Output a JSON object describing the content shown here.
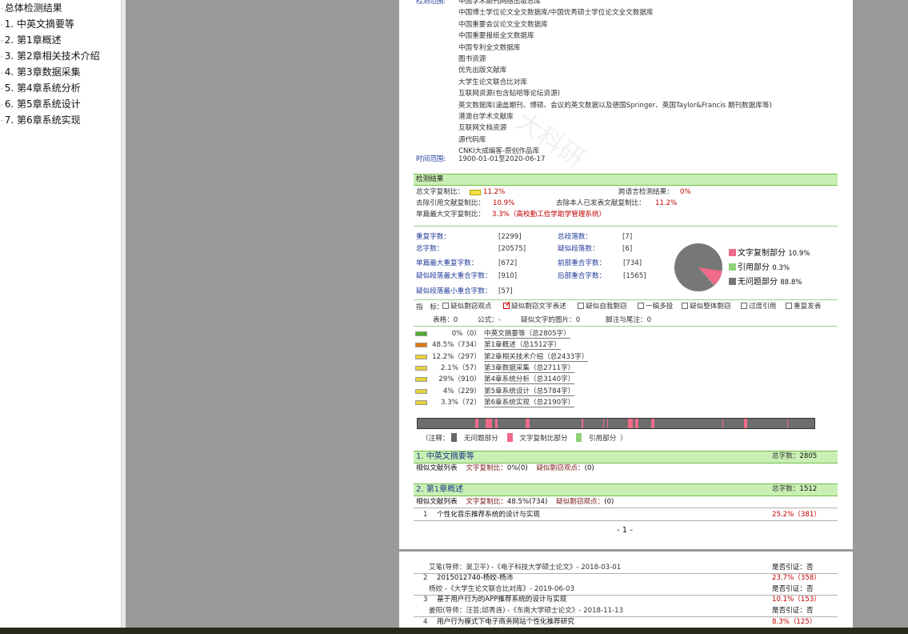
{
  "outline": {
    "items": [
      {
        "label": "总体检测结果"
      },
      {
        "label": "1. 中英文摘要等"
      },
      {
        "label": "2. 第1章概述"
      },
      {
        "label": "3. 第2章相关技术介绍"
      },
      {
        "label": "4. 第3章数据采集"
      },
      {
        "label": "5. 第4章系统分析"
      },
      {
        "label": "6. 第5章系统设计"
      },
      {
        "label": "7. 第6章系统实现"
      }
    ]
  },
  "report": {
    "scope_label": "检测范围:",
    "scope_items": [
      "中国学术期刊网络出版总库",
      "中国博士学位论文全文数据库/中国优秀硕士学位论文全文数据库",
      "中国重要会议论文全文数据库",
      "中国重要报纸全文数据库",
      "中国专利全文数据库",
      "图书资源",
      "优先出版文献库",
      "大学生论文联合比对库",
      "互联网资源(包含贴吧等论坛资源)",
      "英文数据库(涵盖期刊、博硕、会议的英文数据以及德国Springer、英国Taylor&Francis 期刊数据库等)",
      "港澳台学术文献库",
      "互联网文档资源",
      "源代码库",
      "CNKI大成编客-原创作品库"
    ],
    "time_label": "时间范围:",
    "time_value": "1900-01-01至2020-06-17",
    "watermark": "大科研",
    "results_title": "检测结果",
    "total_copy_label": "总文字复制比：",
    "total_copy_value": "11.2%",
    "cross_lang_label": "跨语言检测结果：",
    "cross_lang_value": "0%",
    "excl_ref_label": "去除引用文献复制比：",
    "excl_ref_value": "10.9%",
    "excl_self_label": "去除本人已发表文献复制比：",
    "excl_self_value": "11.2%",
    "single_max_label": "单篇最大文字复制比：",
    "single_max_value": "3.3%（高校勤工俭学助学管理系统）",
    "stats": {
      "dup_chars_label": "重复字数：",
      "dup_chars": "[2299]",
      "total_paras_label": "总段落数：",
      "total_paras": "[7]",
      "total_chars_label": "总字数：",
      "total_chars": "[20575]",
      "sus_paras_label": "疑似段落数：",
      "sus_paras": "[6]",
      "single_max_dup_label": "单篇最大重复字数：",
      "single_max_dup": "[672]",
      "front_overlap_label": "前部重合字数：",
      "front_overlap": "[734]",
      "sus_para_max_label": "疑似段落最大重合字数：",
      "sus_para_max": "[910]",
      "back_overlap_label": "后部重合字数：",
      "back_overlap": "[1565]",
      "sus_para_min_label": "疑似段落最小重合字数：",
      "sus_para_min": "[57]"
    },
    "pie_legend": [
      {
        "label": "文字复制部分",
        "value": "10.9%",
        "color": "#f06a8a"
      },
      {
        "label": "引用部分",
        "value": "0.3%",
        "color": "#8fd27a"
      },
      {
        "label": "无问题部分",
        "value": "88.8%",
        "color": "#777777"
      }
    ],
    "indicators_label": "指　标：",
    "indicators": [
      {
        "label": "疑似剽窃观点",
        "checked": false
      },
      {
        "label": "疑似剽窃文字表述",
        "checked": true
      },
      {
        "label": "疑似自我剽窃",
        "checked": false
      },
      {
        "label": "一稿多投",
        "checked": false
      },
      {
        "label": "疑似整体剽窃",
        "checked": false
      },
      {
        "label": "过度引用",
        "checked": false
      },
      {
        "label": "重复发表",
        "checked": false
      }
    ],
    "misc_line": {
      "tables": "表格：0",
      "formulas": "公式：-",
      "images": "疑似文字的图片：0",
      "footnotes": "脚注与尾注：0"
    },
    "chapters": [
      {
        "pct": "0%（0）",
        "title": "中英文摘要等（总2805字）",
        "color": "#4caf30"
      },
      {
        "pct": "48.5%（734）",
        "title": "第1章概述（总1512字）",
        "color": "#e07a10"
      },
      {
        "pct": "12.2%（297）",
        "title": "第2章相关技术介绍（总2433字）",
        "color": "#e6d23a"
      },
      {
        "pct": "2.1%（57）",
        "title": "第3章数据采集（总2711字）",
        "color": "#e6d23a"
      },
      {
        "pct": "29%（910）",
        "title": "第4章系统分析（总3140字）",
        "color": "#e6d23a"
      },
      {
        "pct": "4%（229）",
        "title": "第5章系统设计（总5784字）",
        "color": "#e6d23a"
      },
      {
        "pct": "3.3%（72）",
        "title": "第6章系统实现（总2190字）",
        "color": "#e6d23a"
      }
    ],
    "legend_note_prefix": "（注释：",
    "legend_note_items": [
      {
        "label": "无问题部分",
        "color": "#666666"
      },
      {
        "label": "文字复制比部分",
        "color": "#f06a8a"
      },
      {
        "label": "引用部分",
        "color": "#8fd27a"
      }
    ],
    "legend_note_suffix": "）",
    "sections": [
      {
        "title": "1. 中英文摘要等",
        "total_label": "总字数：",
        "total_value": "2805",
        "sim_list": "相似文献列表",
        "copy_label": "文字复制比：",
        "copy_value": "0%(0)",
        "plag_label": "疑似剽窃观点：",
        "plag_value": "(0)"
      },
      {
        "title": "2. 第1章概述",
        "total_label": "总字数：",
        "total_value": "1512",
        "sim_list": "相似文献列表",
        "copy_label": "文字复制比：",
        "copy_value": "48.5%(734)",
        "plag_label": "疑似剽窃观点：",
        "plag_value": "(0)"
      }
    ],
    "sec2_row1": {
      "num": "1",
      "title": "个性化音乐推荐系统的设计与实现",
      "pct": "25.2%（381）"
    },
    "page_number": "- 1 -"
  },
  "page2": {
    "rows": [
      {
        "src": "艾笔(导师：吴卫平) -《电子科技大学硕士论文》- 2018-03-01",
        "cite": "是否引证：否"
      },
      {
        "num": "2",
        "title": "2015012740-杨姣-杨沛",
        "pct": "23.7%（358）"
      },
      {
        "src": "杨姣 -《大学生论文联合比对库》- 2019-06-03",
        "cite": "是否引证：否"
      },
      {
        "num": "3",
        "title": "基于用户行为的APP推荐系统的设计与实现",
        "pct": "10.1%（153）"
      },
      {
        "src": "姜阳(导师：汪芸;邱秀连) -《东南大学硕士论文》- 2018-11-13",
        "cite": "是否引证：否"
      },
      {
        "num": "4",
        "title": "用户行为模式下电子商务网站个性化推荐研究",
        "pct": "8.3%（125）"
      }
    ]
  },
  "colors": {
    "header_green": "#c9efb4",
    "copy_pink": "#f06a8a",
    "quote_green": "#8fd27a",
    "ok_gray": "#777777",
    "red_text": "#c00000"
  }
}
